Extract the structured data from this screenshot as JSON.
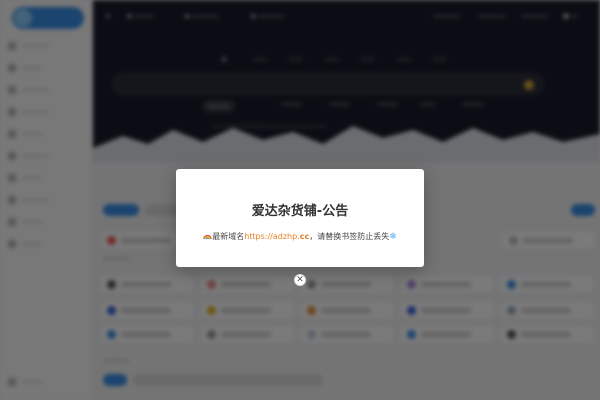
{
  "notice_modal": {
    "title": "爱达杂货铺-公告",
    "body_prefix": "最新域名",
    "link_text": "https://adzhp.",
    "link_tld": "cc",
    "body_suffix": "，请替换书签防止丢失",
    "icon_before": "rainbow-icon",
    "icon_after": "snowflake-icon"
  },
  "close_button": {
    "icon": "close-icon"
  },
  "colors": {
    "hero_bg": "#1a1d2b",
    "accent_blue": "#3a8fe8",
    "link_orange": "#e67e22"
  }
}
